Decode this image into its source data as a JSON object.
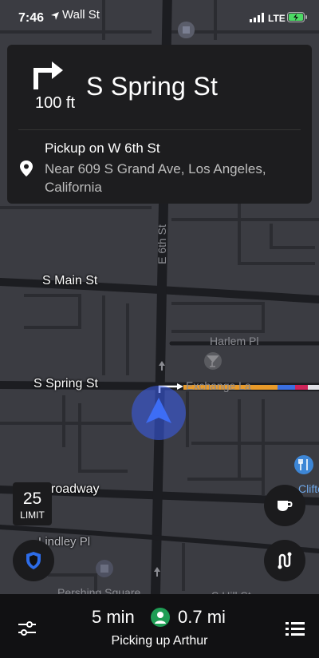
{
  "status_bar": {
    "time": "7:46",
    "location_label": "Wall St",
    "network": "LTE"
  },
  "navigation": {
    "distance": "100 ft",
    "street": "S Spring St",
    "pickup_title": "Pickup on W 6th St",
    "pickup_address": "Near 609 S Grand Ave, Los Angeles, California"
  },
  "map_labels": {
    "main_st": "S Main St",
    "spring_st": "S Spring St",
    "broadway": "roadway",
    "lindley": "Lindley Pl",
    "harlem": "Harlem Pl",
    "exchange": "Exchange La",
    "e6th": "E 6th St",
    "clifton": "Clifton",
    "pershing": "Pershing Square",
    "hill": "S Hill St"
  },
  "speed_limit": {
    "value": "25",
    "label": "LIMIT"
  },
  "trip": {
    "eta": "5 min",
    "distance": "0.7 mi",
    "status": "Picking up Arthur"
  },
  "colors": {
    "map_background": "#3b3c42",
    "road": "#1f2024",
    "card": "#1d1d1f",
    "location_marker": "#3a5cf0",
    "route_orange": "#e89a2a",
    "route_blue": "#3b6fe0",
    "route_red": "#d0245a",
    "shield_blue": "#2d6ce8",
    "avatar_green": "#1f9d55"
  },
  "icons": {
    "turn": "turn-right-icon",
    "pin": "location-pin-icon",
    "cup": "coffee-cup-icon",
    "route": "route-icon",
    "shield": "shield-icon",
    "settings": "settings-sliders-icon",
    "list": "list-icon",
    "avatar": "person-icon"
  }
}
